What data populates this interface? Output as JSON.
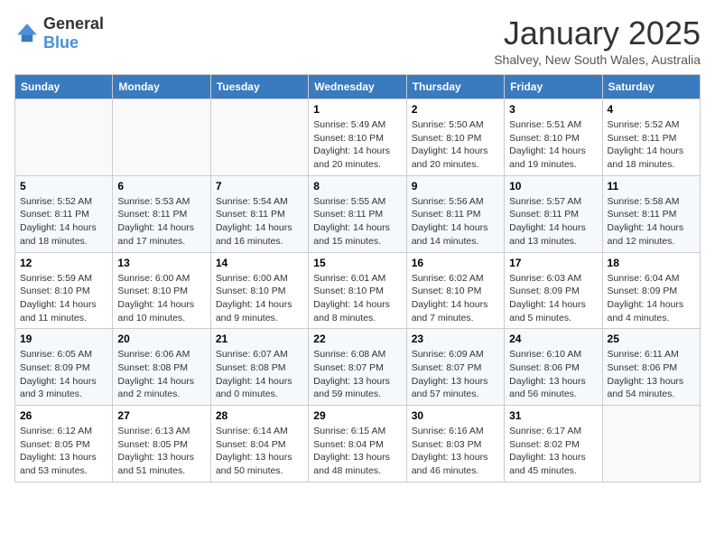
{
  "logo": {
    "text_general": "General",
    "text_blue": "Blue"
  },
  "header": {
    "month": "January 2025",
    "location": "Shalvey, New South Wales, Australia"
  },
  "weekdays": [
    "Sunday",
    "Monday",
    "Tuesday",
    "Wednesday",
    "Thursday",
    "Friday",
    "Saturday"
  ],
  "weeks": [
    [
      {
        "day": "",
        "sunrise": "",
        "sunset": "",
        "daylight": ""
      },
      {
        "day": "",
        "sunrise": "",
        "sunset": "",
        "daylight": ""
      },
      {
        "day": "",
        "sunrise": "",
        "sunset": "",
        "daylight": ""
      },
      {
        "day": "1",
        "sunrise": "Sunrise: 5:49 AM",
        "sunset": "Sunset: 8:10 PM",
        "daylight": "Daylight: 14 hours and 20 minutes."
      },
      {
        "day": "2",
        "sunrise": "Sunrise: 5:50 AM",
        "sunset": "Sunset: 8:10 PM",
        "daylight": "Daylight: 14 hours and 20 minutes."
      },
      {
        "day": "3",
        "sunrise": "Sunrise: 5:51 AM",
        "sunset": "Sunset: 8:10 PM",
        "daylight": "Daylight: 14 hours and 19 minutes."
      },
      {
        "day": "4",
        "sunrise": "Sunrise: 5:52 AM",
        "sunset": "Sunset: 8:11 PM",
        "daylight": "Daylight: 14 hours and 18 minutes."
      }
    ],
    [
      {
        "day": "5",
        "sunrise": "Sunrise: 5:52 AM",
        "sunset": "Sunset: 8:11 PM",
        "daylight": "Daylight: 14 hours and 18 minutes."
      },
      {
        "day": "6",
        "sunrise": "Sunrise: 5:53 AM",
        "sunset": "Sunset: 8:11 PM",
        "daylight": "Daylight: 14 hours and 17 minutes."
      },
      {
        "day": "7",
        "sunrise": "Sunrise: 5:54 AM",
        "sunset": "Sunset: 8:11 PM",
        "daylight": "Daylight: 14 hours and 16 minutes."
      },
      {
        "day": "8",
        "sunrise": "Sunrise: 5:55 AM",
        "sunset": "Sunset: 8:11 PM",
        "daylight": "Daylight: 14 hours and 15 minutes."
      },
      {
        "day": "9",
        "sunrise": "Sunrise: 5:56 AM",
        "sunset": "Sunset: 8:11 PM",
        "daylight": "Daylight: 14 hours and 14 minutes."
      },
      {
        "day": "10",
        "sunrise": "Sunrise: 5:57 AM",
        "sunset": "Sunset: 8:11 PM",
        "daylight": "Daylight: 14 hours and 13 minutes."
      },
      {
        "day": "11",
        "sunrise": "Sunrise: 5:58 AM",
        "sunset": "Sunset: 8:11 PM",
        "daylight": "Daylight: 14 hours and 12 minutes."
      }
    ],
    [
      {
        "day": "12",
        "sunrise": "Sunrise: 5:59 AM",
        "sunset": "Sunset: 8:10 PM",
        "daylight": "Daylight: 14 hours and 11 minutes."
      },
      {
        "day": "13",
        "sunrise": "Sunrise: 6:00 AM",
        "sunset": "Sunset: 8:10 PM",
        "daylight": "Daylight: 14 hours and 10 minutes."
      },
      {
        "day": "14",
        "sunrise": "Sunrise: 6:00 AM",
        "sunset": "Sunset: 8:10 PM",
        "daylight": "Daylight: 14 hours and 9 minutes."
      },
      {
        "day": "15",
        "sunrise": "Sunrise: 6:01 AM",
        "sunset": "Sunset: 8:10 PM",
        "daylight": "Daylight: 14 hours and 8 minutes."
      },
      {
        "day": "16",
        "sunrise": "Sunrise: 6:02 AM",
        "sunset": "Sunset: 8:10 PM",
        "daylight": "Daylight: 14 hours and 7 minutes."
      },
      {
        "day": "17",
        "sunrise": "Sunrise: 6:03 AM",
        "sunset": "Sunset: 8:09 PM",
        "daylight": "Daylight: 14 hours and 5 minutes."
      },
      {
        "day": "18",
        "sunrise": "Sunrise: 6:04 AM",
        "sunset": "Sunset: 8:09 PM",
        "daylight": "Daylight: 14 hours and 4 minutes."
      }
    ],
    [
      {
        "day": "19",
        "sunrise": "Sunrise: 6:05 AM",
        "sunset": "Sunset: 8:09 PM",
        "daylight": "Daylight: 14 hours and 3 minutes."
      },
      {
        "day": "20",
        "sunrise": "Sunrise: 6:06 AM",
        "sunset": "Sunset: 8:08 PM",
        "daylight": "Daylight: 14 hours and 2 minutes."
      },
      {
        "day": "21",
        "sunrise": "Sunrise: 6:07 AM",
        "sunset": "Sunset: 8:08 PM",
        "daylight": "Daylight: 14 hours and 0 minutes."
      },
      {
        "day": "22",
        "sunrise": "Sunrise: 6:08 AM",
        "sunset": "Sunset: 8:07 PM",
        "daylight": "Daylight: 13 hours and 59 minutes."
      },
      {
        "day": "23",
        "sunrise": "Sunrise: 6:09 AM",
        "sunset": "Sunset: 8:07 PM",
        "daylight": "Daylight: 13 hours and 57 minutes."
      },
      {
        "day": "24",
        "sunrise": "Sunrise: 6:10 AM",
        "sunset": "Sunset: 8:06 PM",
        "daylight": "Daylight: 13 hours and 56 minutes."
      },
      {
        "day": "25",
        "sunrise": "Sunrise: 6:11 AM",
        "sunset": "Sunset: 8:06 PM",
        "daylight": "Daylight: 13 hours and 54 minutes."
      }
    ],
    [
      {
        "day": "26",
        "sunrise": "Sunrise: 6:12 AM",
        "sunset": "Sunset: 8:05 PM",
        "daylight": "Daylight: 13 hours and 53 minutes."
      },
      {
        "day": "27",
        "sunrise": "Sunrise: 6:13 AM",
        "sunset": "Sunset: 8:05 PM",
        "daylight": "Daylight: 13 hours and 51 minutes."
      },
      {
        "day": "28",
        "sunrise": "Sunrise: 6:14 AM",
        "sunset": "Sunset: 8:04 PM",
        "daylight": "Daylight: 13 hours and 50 minutes."
      },
      {
        "day": "29",
        "sunrise": "Sunrise: 6:15 AM",
        "sunset": "Sunset: 8:04 PM",
        "daylight": "Daylight: 13 hours and 48 minutes."
      },
      {
        "day": "30",
        "sunrise": "Sunrise: 6:16 AM",
        "sunset": "Sunset: 8:03 PM",
        "daylight": "Daylight: 13 hours and 46 minutes."
      },
      {
        "day": "31",
        "sunrise": "Sunrise: 6:17 AM",
        "sunset": "Sunset: 8:02 PM",
        "daylight": "Daylight: 13 hours and 45 minutes."
      },
      {
        "day": "",
        "sunrise": "",
        "sunset": "",
        "daylight": ""
      }
    ]
  ]
}
